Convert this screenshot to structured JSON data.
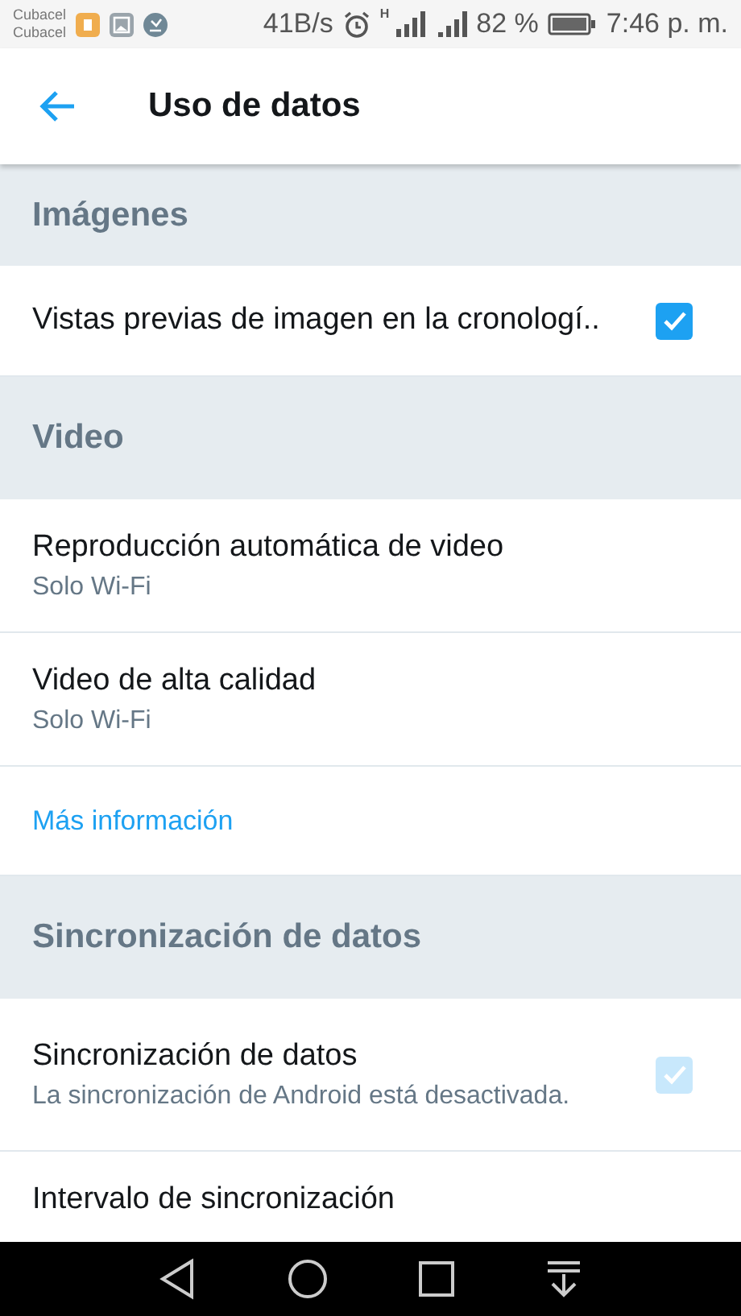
{
  "status_bar": {
    "carriers": [
      "Cubacel",
      "Cubacel"
    ],
    "speed": "41B/s",
    "network_type": "H",
    "battery": "82 %",
    "time": "7:46 p. m."
  },
  "app_bar": {
    "title": "Uso de datos"
  },
  "sections": [
    {
      "header": "Imágenes",
      "items": [
        {
          "kind": "checkbox",
          "title": "Vistas previas de imagen en la cronologí..",
          "checked": true,
          "disabled": false
        }
      ]
    },
    {
      "header": "Video",
      "items": [
        {
          "kind": "setting",
          "title": "Reproducción automática de video",
          "subtitle": "Solo Wi-Fi"
        },
        {
          "kind": "setting",
          "title": "Video de alta calidad",
          "subtitle": "Solo Wi-Fi"
        },
        {
          "kind": "link",
          "title": "Más información"
        }
      ]
    },
    {
      "header": "Sincronización de datos",
      "items": [
        {
          "kind": "checkbox",
          "title": "Sincronización de datos",
          "subtitle": "La sincronización de Android está desactivada.",
          "checked": true,
          "disabled": true
        },
        {
          "kind": "setting",
          "title": "Intervalo de sincronización"
        }
      ]
    }
  ]
}
